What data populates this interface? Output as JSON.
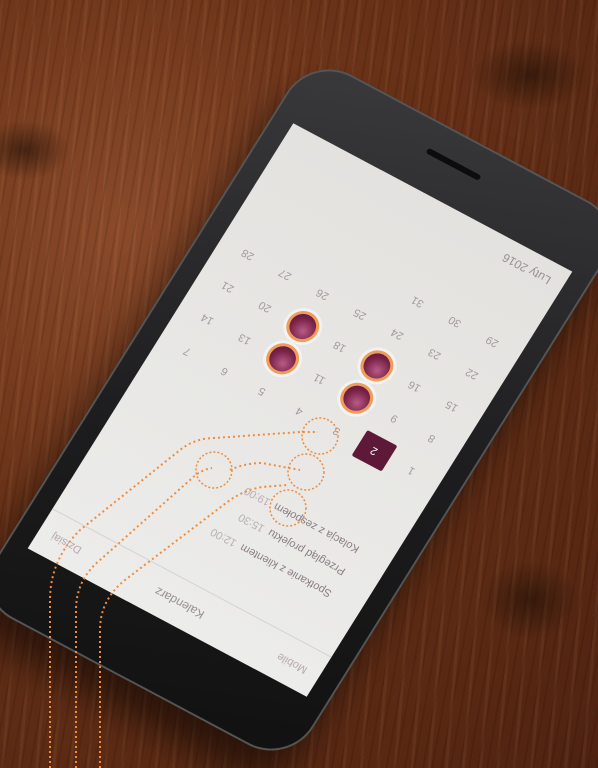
{
  "screen": {
    "nav": {
      "left": "Mobile",
      "title": "Kalendarz",
      "right": "Dzisiaj"
    },
    "events": [
      {
        "title": "Spotkanie z klientem",
        "time": "12:00"
      },
      {
        "title": "Przegląd projektu",
        "time": "15:30"
      },
      {
        "title": "Kolacja z zespołem",
        "time": "19:00"
      }
    ],
    "calendar": {
      "rows": [
        [
          "1",
          "2",
          "3",
          "4",
          "5",
          "6",
          "7"
        ],
        [
          "8",
          "9",
          "10",
          "11",
          "12",
          "13",
          "14"
        ],
        [
          "15",
          "16",
          "17",
          "18",
          "19",
          "20",
          "21"
        ],
        [
          "22",
          "23",
          "24",
          "25",
          "26",
          "27",
          "28"
        ],
        [
          "29",
          "30",
          "31",
          "",
          "",
          "",
          ""
        ]
      ],
      "today": "2",
      "marked": [
        "10",
        "12",
        "17",
        "19"
      ]
    },
    "month": "Luty 2016"
  },
  "colors": {
    "accent": "#5e1838",
    "marker": "#7a2248",
    "callout": "#f08c3c"
  }
}
